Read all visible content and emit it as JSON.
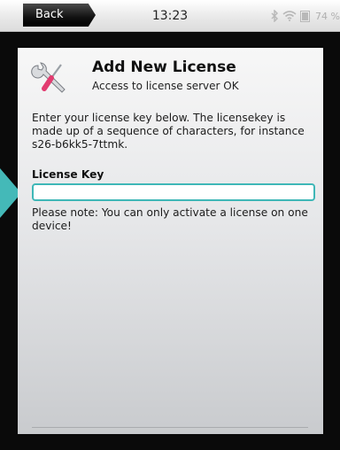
{
  "status_bar": {
    "back_label": "Back",
    "time": "13:23",
    "battery": "74 %",
    "icons": [
      "bluetooth-icon",
      "wifi-icon",
      "battery-icon"
    ]
  },
  "dialog": {
    "icon": "tools-icon",
    "title": "Add New License",
    "subtitle": "Access to license server OK",
    "intro": "Enter your license key below. The licensekey is made up of a sequence of characters, for instance s26-b6kk5-7ttmk.",
    "field_label": "License Key",
    "field_value": "",
    "note": "Please note: You can only activate a license on one device!"
  },
  "colors": {
    "accent": "#44b9b8",
    "input_border": "#3fb7b7",
    "frame": "#0a0a0a"
  }
}
